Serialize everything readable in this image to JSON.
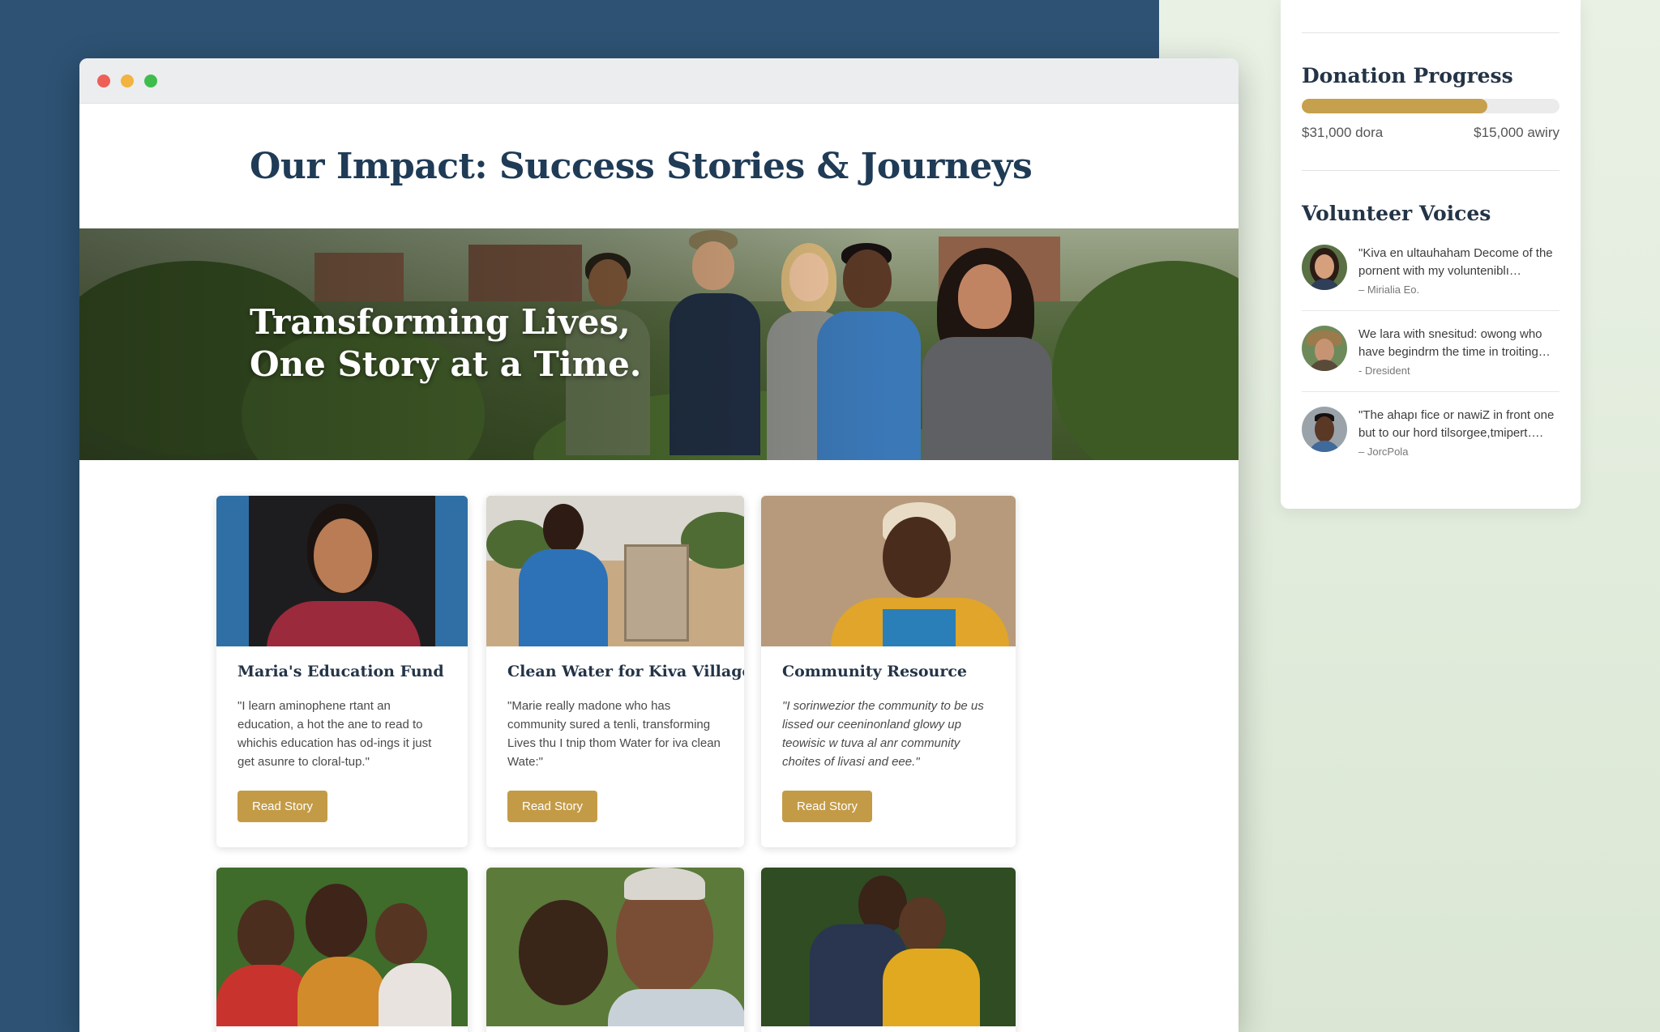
{
  "page": {
    "title": "Our Impact: Success Stories & Journeys",
    "hero_line1": "Transforming Lives,",
    "hero_line2": "One Story at a Time."
  },
  "colors": {
    "navy_background": "#2d5273",
    "title": "#1f3b56",
    "button_gold": "#c39b47",
    "progress_gold": "#c6a04c"
  },
  "stories": [
    {
      "title": "Maria's Education Fund",
      "text": "\"I learn aminophene rtant an education, a hot the ane to read to whichis education has od-ings it just get asunre to cloral-tup.\"",
      "button": "Read Story"
    },
    {
      "title": "Clean Water for Kiva Village",
      "text": "\"Marie really madone who has community sured a tenli, transforming Lives thu I tnip thom Water for iva clean Wate:\"",
      "button": "Read Story"
    },
    {
      "title": "Community Resource",
      "text": "\"I sorinwezior the community to be us lissed our ceeninonland glowy up teowisic w tuva al anr community choites of livasi and eee.\"",
      "button": "Read Story"
    }
  ],
  "donation": {
    "heading": "Donation Progress",
    "progress_fraction": 0.72,
    "left_label": "$31,000 dora",
    "right_label": "$15,000 awiry"
  },
  "volunteers": {
    "heading": "Volunteer Voices",
    "items": [
      {
        "quote": "\"Kiva en ultauhaham Decome of the pornent with my volunteniblı…",
        "author": "– Mirialia Eo."
      },
      {
        "quote": "We lara with snesitud: owong who have begindrm the time in troiting…",
        "author": "- Dresident"
      },
      {
        "quote": "\"The ahapı fice or nawiZ in front one but to our hord tilsorgee,tmipert….",
        "author": "– JorcPola"
      }
    ]
  }
}
